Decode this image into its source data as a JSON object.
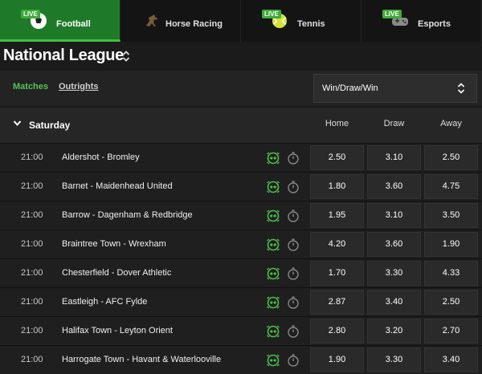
{
  "sport_tabs": [
    {
      "label": "Football",
      "live": "LIVE",
      "icon": "football-icon"
    },
    {
      "label": "Horse Racing",
      "live": "",
      "icon": "horse-racing-icon"
    },
    {
      "label": "Tennis",
      "live": "LIVE",
      "icon": "tennis-ball-icon"
    },
    {
      "label": "Esports",
      "live": "LIVE",
      "icon": "gamepad-icon"
    }
  ],
  "league": {
    "title": "National League"
  },
  "filters": {
    "matches": "Matches",
    "outrights": "Outrights",
    "market": "Win/Draw/Win"
  },
  "day": {
    "label": "Saturday"
  },
  "columns": {
    "home": "Home",
    "draw": "Draw",
    "away": "Away"
  },
  "colors": {
    "accent": "#3fbf3f",
    "active_tab": "#1e7a28"
  },
  "matches": [
    {
      "time": "21:00",
      "teams": "Aldershot  -  Bromley",
      "home": "2.50",
      "draw": "3.10",
      "away": "2.50"
    },
    {
      "time": "21:00",
      "teams": "Barnet  -  Maidenhead United",
      "home": "1.80",
      "draw": "3.60",
      "away": "4.75"
    },
    {
      "time": "21:00",
      "teams": "Barrow  -  Dagenham & Redbridge",
      "home": "1.95",
      "draw": "3.10",
      "away": "3.50"
    },
    {
      "time": "21:00",
      "teams": "Braintree Town  -  Wrexham",
      "home": "4.20",
      "draw": "3.60",
      "away": "1.90"
    },
    {
      "time": "21:00",
      "teams": "Chesterfield  -  Dover Athletic",
      "home": "1.70",
      "draw": "3.30",
      "away": "4.33"
    },
    {
      "time": "21:00",
      "teams": "Eastleigh  -  AFC Fylde",
      "home": "2.87",
      "draw": "3.40",
      "away": "2.50"
    },
    {
      "time": "21:00",
      "teams": "Halifax Town  -  Leyton Orient",
      "home": "2.80",
      "draw": "3.20",
      "away": "2.70"
    },
    {
      "time": "21:00",
      "teams": "Harrogate Town  -  Havant & Waterlooville",
      "home": "1.90",
      "draw": "3.30",
      "away": "3.40"
    }
  ]
}
